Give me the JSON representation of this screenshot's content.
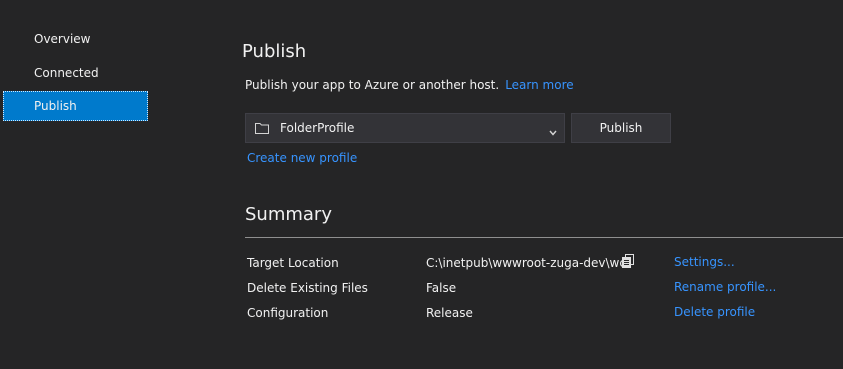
{
  "sidebar": {
    "items": [
      {
        "label": "Overview",
        "active": false
      },
      {
        "label": "Connected Services",
        "active": false
      },
      {
        "label": "Publish",
        "active": true
      }
    ]
  },
  "main": {
    "title": "Publish",
    "description": "Publish your app to Azure or another host.",
    "learn_more": "Learn more",
    "profile_select": {
      "value": "FolderProfile",
      "icon": "folder-icon"
    },
    "publish_button": "Publish",
    "create_profile_link": "Create new profile"
  },
  "summary": {
    "title": "Summary",
    "rows": [
      {
        "label": "Target Location",
        "value": "C:\\inetpub\\wwwroot-zuga-dev\\wcf",
        "action": "Settings..."
      },
      {
        "label": "Delete Existing Files",
        "value": "False",
        "action": "Rename profile..."
      },
      {
        "label": "Configuration",
        "value": "Release",
        "action": "Delete profile"
      }
    ]
  },
  "colors": {
    "background": "#252526",
    "accent": "#007acc",
    "link": "#3794ff",
    "text": "#f1f1f1",
    "control": "#333337"
  }
}
